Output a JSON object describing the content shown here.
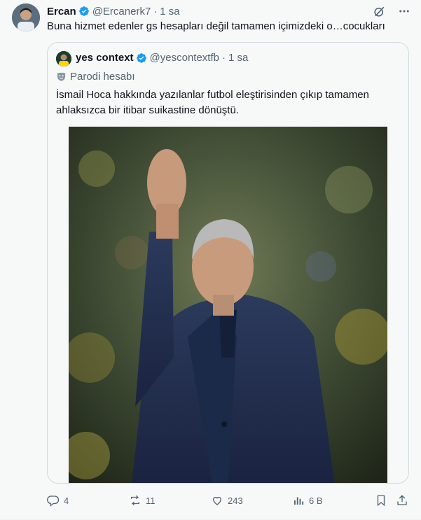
{
  "tweet": {
    "author_name": "Ercan",
    "author_handle": "@Ercanerk7",
    "separator": "·",
    "time": "1 sa",
    "text": "Buna hizmet edenler gs hesapları değil tamamen içimizdeki o…cocukları"
  },
  "quoted": {
    "author_name": "yes context",
    "author_handle": "@yescontextfb",
    "separator": "·",
    "time": "1 sa",
    "label": "Parodi hesabı",
    "text": "İsmail Hoca hakkında yazılanlar futbol eleştirisinden çıkıp tamamen ahlaksızca bir itibar suikastine dönüştü."
  },
  "actions": {
    "replies": "4",
    "reposts": "11",
    "likes": "243",
    "views": "6 B"
  },
  "colors": {
    "verified": "#1d9bf0",
    "muted_text": "#536471",
    "border": "#cfd9de"
  },
  "icons": [
    "verified-badge-icon",
    "grok-icon",
    "more-icon",
    "parody-mask-icon",
    "reply-icon",
    "repost-icon",
    "like-icon",
    "views-icon",
    "bookmark-icon",
    "share-icon"
  ]
}
